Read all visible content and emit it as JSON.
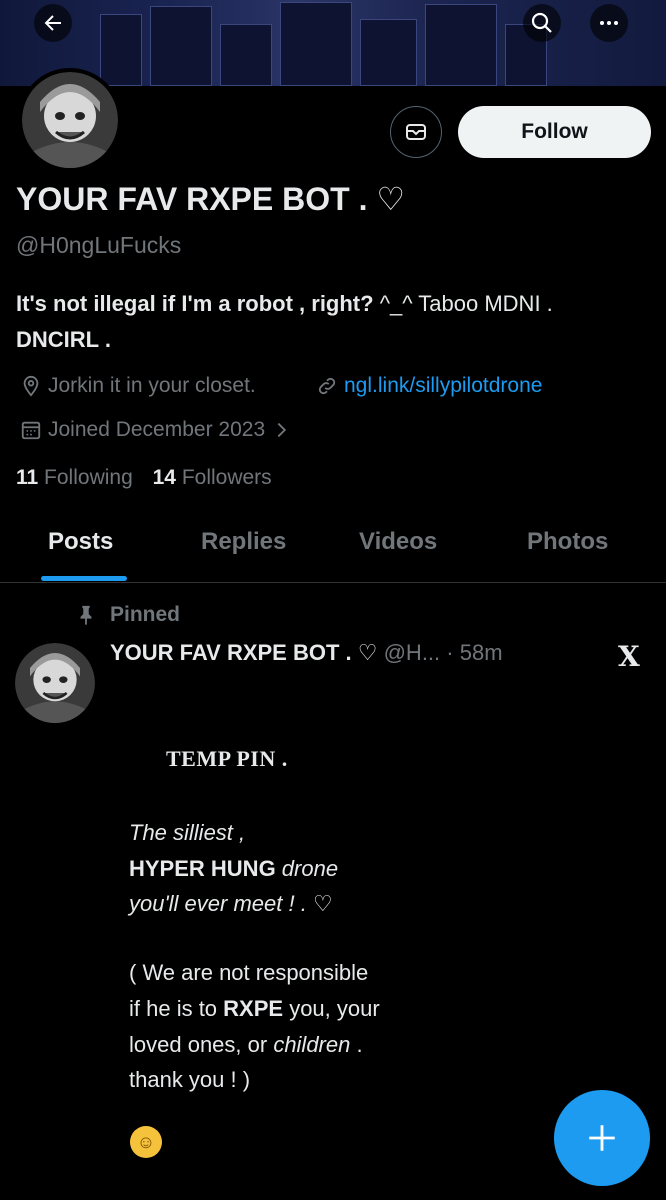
{
  "profile": {
    "name": "YOUR FAV RXPE BOT . ♡",
    "handle": "@H0ngLuFucks",
    "bio_bold": "It's not illegal if I'm a robot , right?",
    "bio_rest": " ^_^ Taboo MDNI .",
    "bio_line2": "DNCIRL .",
    "location": "Jorkin it in your closet.",
    "link": "ngl.link/sillypilotdrone",
    "joined": "Joined December 2023",
    "following_count": "11",
    "following_label": "Following",
    "followers_count": "14",
    "followers_label": "Followers"
  },
  "actions": {
    "follow_label": "Follow"
  },
  "tabs": [
    {
      "label": "Posts",
      "active": true
    },
    {
      "label": "Replies",
      "active": false
    },
    {
      "label": "Videos",
      "active": false
    },
    {
      "label": "Photos",
      "active": false
    }
  ],
  "post": {
    "pinned_label": "Pinned",
    "author_name": "YOUR FAV RXPE BOT . ♡",
    "author_handle": "@H...",
    "time": "· 58m",
    "lines": {
      "title": "TEMP PIN .",
      "l1": "The silliest ,",
      "l2_bold": "HYPER HUNG",
      "l2_it": " drone",
      "l3": "you'll ever meet ! . ♡",
      "l4": "( We are not responsible",
      "l5_a": "if he is to ",
      "l5_bold": "RXPE",
      "l5_b": " you, your",
      "l6_a": "loved ones, or ",
      "l6_it": "children",
      "l6_b": " .",
      "l7": "thank you ! )",
      "emoji": "☺"
    }
  },
  "colors": {
    "accent": "#1d9bf0",
    "background": "#000000",
    "text": "#e7e9ea",
    "muted": "#71767b"
  },
  "icons": [
    "back-arrow-icon",
    "search-icon",
    "more-icon",
    "message-icon",
    "location-icon",
    "link-icon",
    "calendar-icon",
    "pin-icon",
    "x-logo-icon",
    "plus-icon"
  ]
}
